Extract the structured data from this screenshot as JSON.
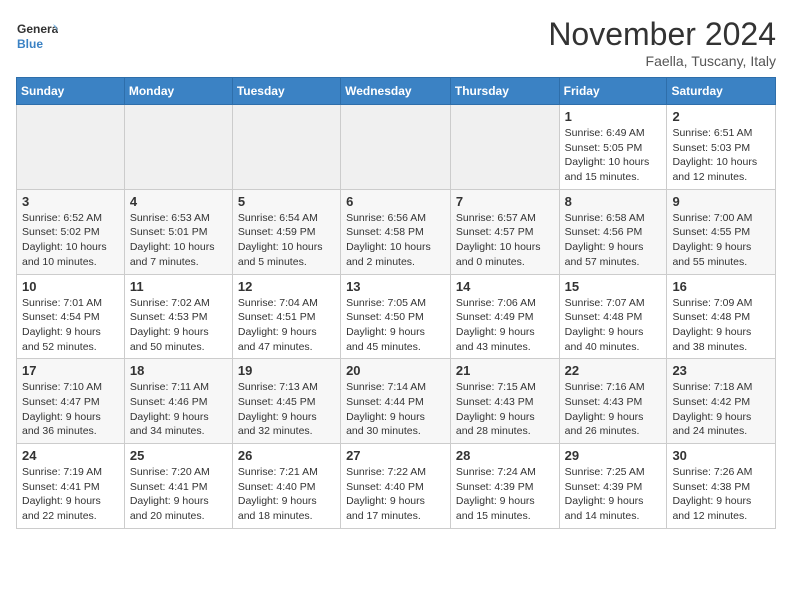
{
  "header": {
    "logo_line1": "General",
    "logo_line2": "Blue",
    "month": "November 2024",
    "location": "Faella, Tuscany, Italy"
  },
  "weekdays": [
    "Sunday",
    "Monday",
    "Tuesday",
    "Wednesday",
    "Thursday",
    "Friday",
    "Saturday"
  ],
  "weeks": [
    [
      {
        "day": "",
        "info": ""
      },
      {
        "day": "",
        "info": ""
      },
      {
        "day": "",
        "info": ""
      },
      {
        "day": "",
        "info": ""
      },
      {
        "day": "",
        "info": ""
      },
      {
        "day": "1",
        "info": "Sunrise: 6:49 AM\nSunset: 5:05 PM\nDaylight: 10 hours and 15 minutes."
      },
      {
        "day": "2",
        "info": "Sunrise: 6:51 AM\nSunset: 5:03 PM\nDaylight: 10 hours and 12 minutes."
      }
    ],
    [
      {
        "day": "3",
        "info": "Sunrise: 6:52 AM\nSunset: 5:02 PM\nDaylight: 10 hours and 10 minutes."
      },
      {
        "day": "4",
        "info": "Sunrise: 6:53 AM\nSunset: 5:01 PM\nDaylight: 10 hours and 7 minutes."
      },
      {
        "day": "5",
        "info": "Sunrise: 6:54 AM\nSunset: 4:59 PM\nDaylight: 10 hours and 5 minutes."
      },
      {
        "day": "6",
        "info": "Sunrise: 6:56 AM\nSunset: 4:58 PM\nDaylight: 10 hours and 2 minutes."
      },
      {
        "day": "7",
        "info": "Sunrise: 6:57 AM\nSunset: 4:57 PM\nDaylight: 10 hours and 0 minutes."
      },
      {
        "day": "8",
        "info": "Sunrise: 6:58 AM\nSunset: 4:56 PM\nDaylight: 9 hours and 57 minutes."
      },
      {
        "day": "9",
        "info": "Sunrise: 7:00 AM\nSunset: 4:55 PM\nDaylight: 9 hours and 55 minutes."
      }
    ],
    [
      {
        "day": "10",
        "info": "Sunrise: 7:01 AM\nSunset: 4:54 PM\nDaylight: 9 hours and 52 minutes."
      },
      {
        "day": "11",
        "info": "Sunrise: 7:02 AM\nSunset: 4:53 PM\nDaylight: 9 hours and 50 minutes."
      },
      {
        "day": "12",
        "info": "Sunrise: 7:04 AM\nSunset: 4:51 PM\nDaylight: 9 hours and 47 minutes."
      },
      {
        "day": "13",
        "info": "Sunrise: 7:05 AM\nSunset: 4:50 PM\nDaylight: 9 hours and 45 minutes."
      },
      {
        "day": "14",
        "info": "Sunrise: 7:06 AM\nSunset: 4:49 PM\nDaylight: 9 hours and 43 minutes."
      },
      {
        "day": "15",
        "info": "Sunrise: 7:07 AM\nSunset: 4:48 PM\nDaylight: 9 hours and 40 minutes."
      },
      {
        "day": "16",
        "info": "Sunrise: 7:09 AM\nSunset: 4:48 PM\nDaylight: 9 hours and 38 minutes."
      }
    ],
    [
      {
        "day": "17",
        "info": "Sunrise: 7:10 AM\nSunset: 4:47 PM\nDaylight: 9 hours and 36 minutes."
      },
      {
        "day": "18",
        "info": "Sunrise: 7:11 AM\nSunset: 4:46 PM\nDaylight: 9 hours and 34 minutes."
      },
      {
        "day": "19",
        "info": "Sunrise: 7:13 AM\nSunset: 4:45 PM\nDaylight: 9 hours and 32 minutes."
      },
      {
        "day": "20",
        "info": "Sunrise: 7:14 AM\nSunset: 4:44 PM\nDaylight: 9 hours and 30 minutes."
      },
      {
        "day": "21",
        "info": "Sunrise: 7:15 AM\nSunset: 4:43 PM\nDaylight: 9 hours and 28 minutes."
      },
      {
        "day": "22",
        "info": "Sunrise: 7:16 AM\nSunset: 4:43 PM\nDaylight: 9 hours and 26 minutes."
      },
      {
        "day": "23",
        "info": "Sunrise: 7:18 AM\nSunset: 4:42 PM\nDaylight: 9 hours and 24 minutes."
      }
    ],
    [
      {
        "day": "24",
        "info": "Sunrise: 7:19 AM\nSunset: 4:41 PM\nDaylight: 9 hours and 22 minutes."
      },
      {
        "day": "25",
        "info": "Sunrise: 7:20 AM\nSunset: 4:41 PM\nDaylight: 9 hours and 20 minutes."
      },
      {
        "day": "26",
        "info": "Sunrise: 7:21 AM\nSunset: 4:40 PM\nDaylight: 9 hours and 18 minutes."
      },
      {
        "day": "27",
        "info": "Sunrise: 7:22 AM\nSunset: 4:40 PM\nDaylight: 9 hours and 17 minutes."
      },
      {
        "day": "28",
        "info": "Sunrise: 7:24 AM\nSunset: 4:39 PM\nDaylight: 9 hours and 15 minutes."
      },
      {
        "day": "29",
        "info": "Sunrise: 7:25 AM\nSunset: 4:39 PM\nDaylight: 9 hours and 14 minutes."
      },
      {
        "day": "30",
        "info": "Sunrise: 7:26 AM\nSunset: 4:38 PM\nDaylight: 9 hours and 12 minutes."
      }
    ]
  ]
}
